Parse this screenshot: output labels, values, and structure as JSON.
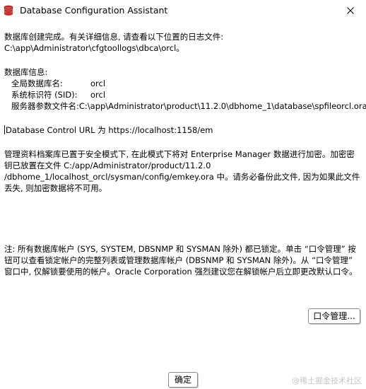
{
  "window": {
    "title": "Database Configuration Assistant",
    "close_icon": "close-icon",
    "app_icon": "dbca-app-icon"
  },
  "message": {
    "completion_line": "数据库创建完成。有关详细信息, 请查看以下位置的日志文件:",
    "log_path": " C:\\app\\Administrator\\cfgtoollogs\\dbca\\orcl。",
    "info_heading": "数据库信息:",
    "info_rows": [
      {
        "label": "全局数据库名:",
        "value": "orcl"
      },
      {
        "label": "系统标识符 (SID):",
        "value": "orcl"
      },
      {
        "label": "服务器参数文件名:",
        "value": "C:\\app\\Administrator\\product\\11.2.0\\dbhome_1\\database\\spfileorcl.ora"
      }
    ],
    "control_url": "Database Control URL 为 https://localhost:1158/em",
    "encryption_note": "管理资料档案库已置于安全模式下, 在此模式下将对 Enterprise Manager 数据进行加密。加密密钥已放置在文件 C:/app/Administrator/product/11.2.0 /dbhome_1/localhost_orcl/sysman/config/emkey.ora 中。请务必备份此文件, 因为如果此文件丢失, 则加密数据将不可用。",
    "accounts_note": "注: 所有数据库帐户 (SYS, SYSTEM, DBSNMP 和 SYSMAN 除外) 都已锁定。单击 “口令管理” 按钮可以查看锁定帐户的完整列表或管理数据库帐户 (DBSNMP 和 SYSMAN 除外)。从 “口令管理” 窗口中, 仅解锁要使用的帐户。Oracle Corporation 强烈建议您在解锁帐户后立即更改默认口令。"
  },
  "buttons": {
    "password_management": "口令管理...",
    "ok": "确定"
  },
  "watermark": "@稀土掘金技术社区"
}
